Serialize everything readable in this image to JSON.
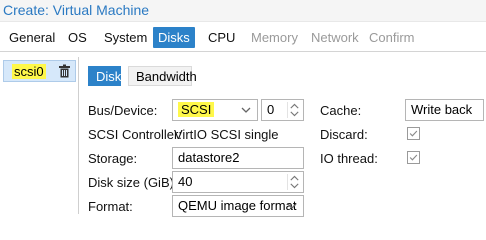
{
  "window": {
    "title": "Create: Virtual Machine"
  },
  "tabs": [
    {
      "label": "General",
      "state": "normal"
    },
    {
      "label": "OS",
      "state": "normal"
    },
    {
      "label": "System",
      "state": "normal"
    },
    {
      "label": "Disks",
      "state": "active"
    },
    {
      "label": "CPU",
      "state": "normal"
    },
    {
      "label": "Memory",
      "state": "disabled"
    },
    {
      "label": "Network",
      "state": "disabled"
    },
    {
      "label": "Confirm",
      "state": "disabled"
    }
  ],
  "disk_list": {
    "items": [
      {
        "label": "scsi0",
        "icon": "trash-icon"
      }
    ]
  },
  "subtabs": [
    {
      "label": "Disk",
      "state": "active"
    },
    {
      "label": "Bandwidth",
      "state": "normal"
    }
  ],
  "form": {
    "bus_device": {
      "label": "Bus/Device:",
      "bus": "SCSI",
      "device": "0"
    },
    "scsi_controller": {
      "label": "SCSI Controller:",
      "value": "VirtIO SCSI single"
    },
    "storage": {
      "label": "Storage:",
      "value": "datastore2"
    },
    "disk_size": {
      "label": "Disk size (GiB):",
      "value": "40"
    },
    "format": {
      "label": "Format:",
      "value": "QEMU image format"
    },
    "cache": {
      "label": "Cache:",
      "value": "Write back"
    },
    "discard": {
      "label": "Discard:",
      "checked": true
    },
    "io_thread": {
      "label": "IO thread:",
      "checked": true
    }
  },
  "colors": {
    "accent": "#2c82c9",
    "title": "#2a79c2",
    "highlight": "#fff84a"
  }
}
